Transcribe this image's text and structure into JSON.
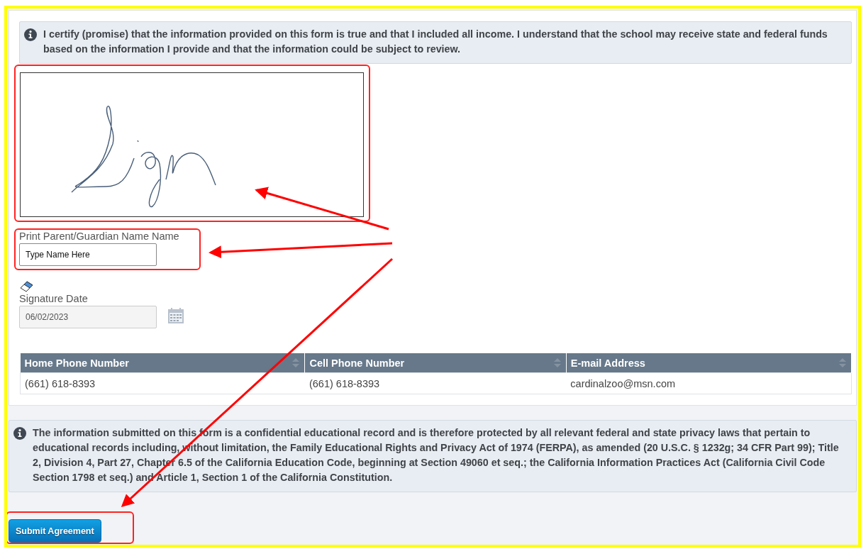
{
  "certify_notice": {
    "text": "I certify (promise) that the information provided on this form is true and that I included all income. I understand that the school may receive state and federal funds based on the information I provide and that the information could be subject to review."
  },
  "name_field": {
    "label": "Print Parent/Guardian Name Name",
    "value": "Type Name Here"
  },
  "date_field": {
    "label": "Signature Date",
    "value": "06/02/2023"
  },
  "contact_table": {
    "columns": [
      "Home Phone Number",
      "Cell Phone Number",
      "E-mail Address"
    ],
    "rows": [
      [
        "(661) 618-8393",
        "(661) 618-8393",
        "cardinalzoo@msn.com"
      ]
    ]
  },
  "privacy_notice": {
    "text": "The information submitted on this form is a confidential educational record and is therefore protected by all relevant federal and state privacy laws that pertain to educational records including, without limitation, the Family Educational Rights and Privacy Act of 1974 (FERPA), as amended (20 U.S.C. § 1232g; 34 CFR Part 99); Title 2, Division 4, Part 27, Chapter 6.5 of the California Education Code, beginning at Section 49060 et seq.; the California Information Practices Act (California Civil Code Section 1798 et seq.) and Article 1, Section 1 of the California Constitution."
  },
  "submit_button": {
    "label": "Submit Agreement"
  }
}
